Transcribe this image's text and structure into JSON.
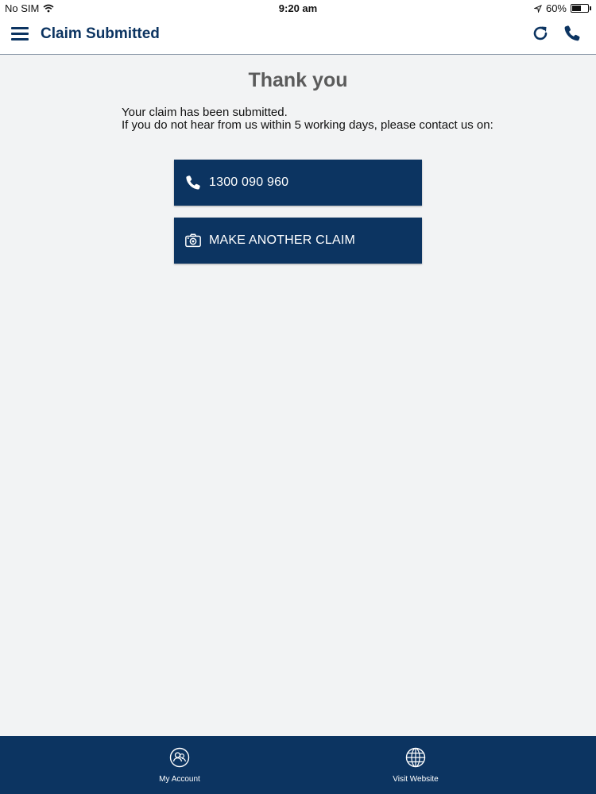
{
  "status_bar": {
    "carrier": "No SIM",
    "time": "9:20 am",
    "battery": "60%",
    "battery_level": 0.6
  },
  "header": {
    "title": "Claim Submitted",
    "menu_icon": "hamburger-menu-icon",
    "refresh_icon": "refresh-icon",
    "phone_icon": "phone-icon"
  },
  "main": {
    "title": "Thank you",
    "message_line1": "Your claim has been submitted.",
    "message_line2": "If you do not hear from us within 5 working days, please contact us on:",
    "call_button": {
      "label": "1300 090 960",
      "icon": "phone-icon"
    },
    "claim_button": {
      "label": "MAKE ANOTHER CLAIM",
      "icon": "camera-icon"
    }
  },
  "bottom_nav": {
    "items": [
      {
        "label": "My Account",
        "icon": "account-icon"
      },
      {
        "label": "Visit Website",
        "icon": "globe-icon"
      }
    ]
  },
  "colors": {
    "primary": "#0c3461",
    "background": "#f2f3f4",
    "title_gray": "#5b5b5b"
  }
}
